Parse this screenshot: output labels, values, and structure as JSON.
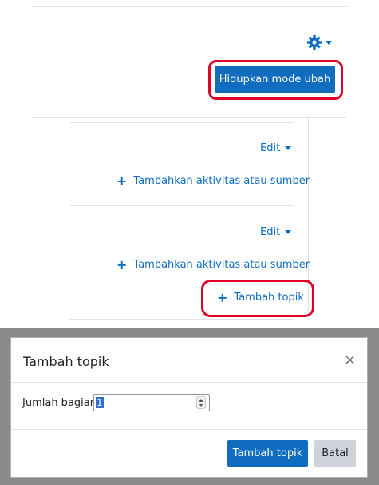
{
  "header": {
    "settings_icon": "gear-icon",
    "edit_mode_button": "Hidupkan mode ubah"
  },
  "sections": [
    {
      "edit_label": "Edit",
      "add_activity_label": "Tambahkan aktivitas atau sumber"
    },
    {
      "edit_label": "Edit",
      "add_activity_label": "Tambahkan aktivitas atau sumber"
    }
  ],
  "add_topic_link": "Tambah topik",
  "modal": {
    "title": "Tambah topik",
    "close_label": "×",
    "field_label": "Jumlah bagian",
    "field_value": "1",
    "submit_label": "Tambah topik",
    "cancel_label": "Batal"
  },
  "colors": {
    "brand": "#0f6cbf",
    "annotation": "#e0002a",
    "backdrop": "#8a8a8a"
  }
}
